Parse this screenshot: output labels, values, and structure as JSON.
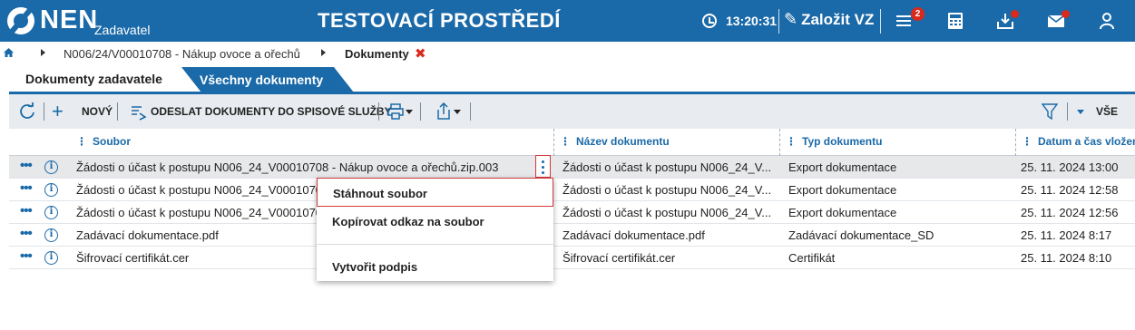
{
  "header": {
    "logo": "NEN",
    "logo_sub": "Zadavatel",
    "environment": "TESTOVACÍ PROSTŘEDÍ",
    "time": "13:20:31",
    "new_vz": "Založit VZ",
    "menu_badge": "2",
    "colors": {
      "primary": "#1a69a8",
      "alert": "#d92a1c"
    }
  },
  "breadcrumb": {
    "items": [
      "N006/24/V00010708 - Nákup ovoce a ořechů",
      "Dokumenty"
    ]
  },
  "tabs": [
    {
      "label": "Dokumenty zadavatele",
      "active": true
    },
    {
      "label": "Všechny dokumenty",
      "active": false
    }
  ],
  "toolbar": {
    "new_label": "NOVÝ",
    "send_label": "ODESLAT DOKUMENTY DO SPISOVÉ SLUŽBY",
    "filter_label": "VŠE"
  },
  "grid": {
    "columns": [
      "Soubor",
      "Název dokumentu",
      "Typ dokumentu",
      "Datum a čas vložení"
    ],
    "rows": [
      {
        "soubor": "Žádosti o účast k postupu N006_24_V00010708 - Nákup ovoce a ořechů.zip.003",
        "nazev": "Žádosti o účast k postupu N006_24_V...",
        "typ": "Export dokumentace",
        "datum": "25. 11. 2024 13:00"
      },
      {
        "soubor": "Žádosti o účast k postupu N006_24_V0001070",
        "nazev": "Žádosti o účast k postupu N006_24_V...",
        "typ": "Export dokumentace",
        "datum": "25. 11. 2024 12:58"
      },
      {
        "soubor": "Žádosti o účast k postupu N006_24_V0001070",
        "nazev": "Žádosti o účast k postupu N006_24_V...",
        "typ": "Export dokumentace",
        "datum": "25. 11. 2024 12:56"
      },
      {
        "soubor": "Zadávací dokumentace.pdf",
        "nazev": "Zadávací dokumentace.pdf",
        "typ": "Zadávací dokumentace_SD",
        "datum": "25. 11. 2024 8:17"
      },
      {
        "soubor": "Šifrovací certifikát.cer",
        "nazev": "Šifrovací certifikát.cer",
        "typ": "Certifikát",
        "datum": "25. 11. 2024 8:10"
      }
    ]
  },
  "context_menu": {
    "items": [
      "Stáhnout soubor",
      "Kopírovat odkaz na soubor",
      "Vytvořit podpis"
    ]
  }
}
